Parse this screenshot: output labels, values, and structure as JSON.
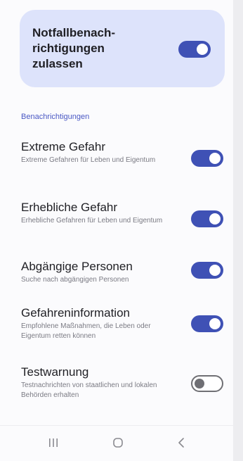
{
  "master": {
    "title": "Notfallbenach-\nrichtigungen\nzulassen",
    "enabled": true
  },
  "section_label": "Benachrichtigungen",
  "items": [
    {
      "title": "Extreme Gefahr",
      "subtitle": "Extreme Gefahren für Leben und Eigentum",
      "enabled": true
    },
    {
      "title": "Erhebliche Gefahr",
      "subtitle": "Erhebliche Gefahren für Leben und Eigentum",
      "enabled": true
    },
    {
      "title": "Abgängige Personen",
      "subtitle": "Suche nach abgängigen Personen",
      "enabled": true
    },
    {
      "title": "Gefahreninformation",
      "subtitle": "Empfohlene Maßnahmen, die Leben oder Eigentum retten können",
      "enabled": true
    },
    {
      "title": "Testwarnung",
      "subtitle": "Testnachrichten von staatlichen und lokalen Behörden erhalten",
      "enabled": false
    }
  ],
  "colors": {
    "accent": "#3f51b5",
    "card_bg": "#dde3fb",
    "section_label": "#4a58c4"
  },
  "nav": {
    "icons": [
      "recent-apps-icon",
      "home-icon",
      "back-icon"
    ]
  }
}
